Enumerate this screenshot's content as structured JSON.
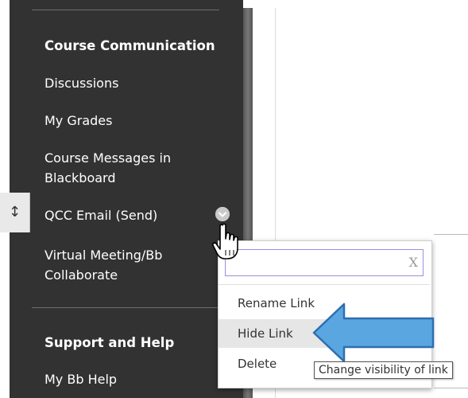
{
  "sidebar": {
    "section1_heading": "Course Communication",
    "items": [
      {
        "label": "Discussions"
      },
      {
        "label": "My Grades"
      },
      {
        "label_line1": "Course Messages in",
        "label_line2": "Blackboard"
      },
      {
        "label": "QCC Email (Send)"
      },
      {
        "label_line1": "Virtual Meeting/Bb",
        "label_line2": "Collaborate"
      }
    ],
    "section2_heading": "Support and Help",
    "help_item": "My Bb Help",
    "drag_handle_icon": "up-down-arrow-icon",
    "item_options_icon": "chevron-down-icon"
  },
  "menu": {
    "input_close": "X",
    "items": [
      {
        "label": "Rename Link"
      },
      {
        "label": "Hide Link",
        "highlighted": true
      },
      {
        "label": "Delete"
      }
    ]
  },
  "tooltip": "Change visibility of link",
  "colors": {
    "sidebar_bg": "#333232",
    "menu_highlight": "#e6e6e6",
    "arrow_fill": "#5aa6e0",
    "arrow_stroke": "#2d6fb0"
  }
}
